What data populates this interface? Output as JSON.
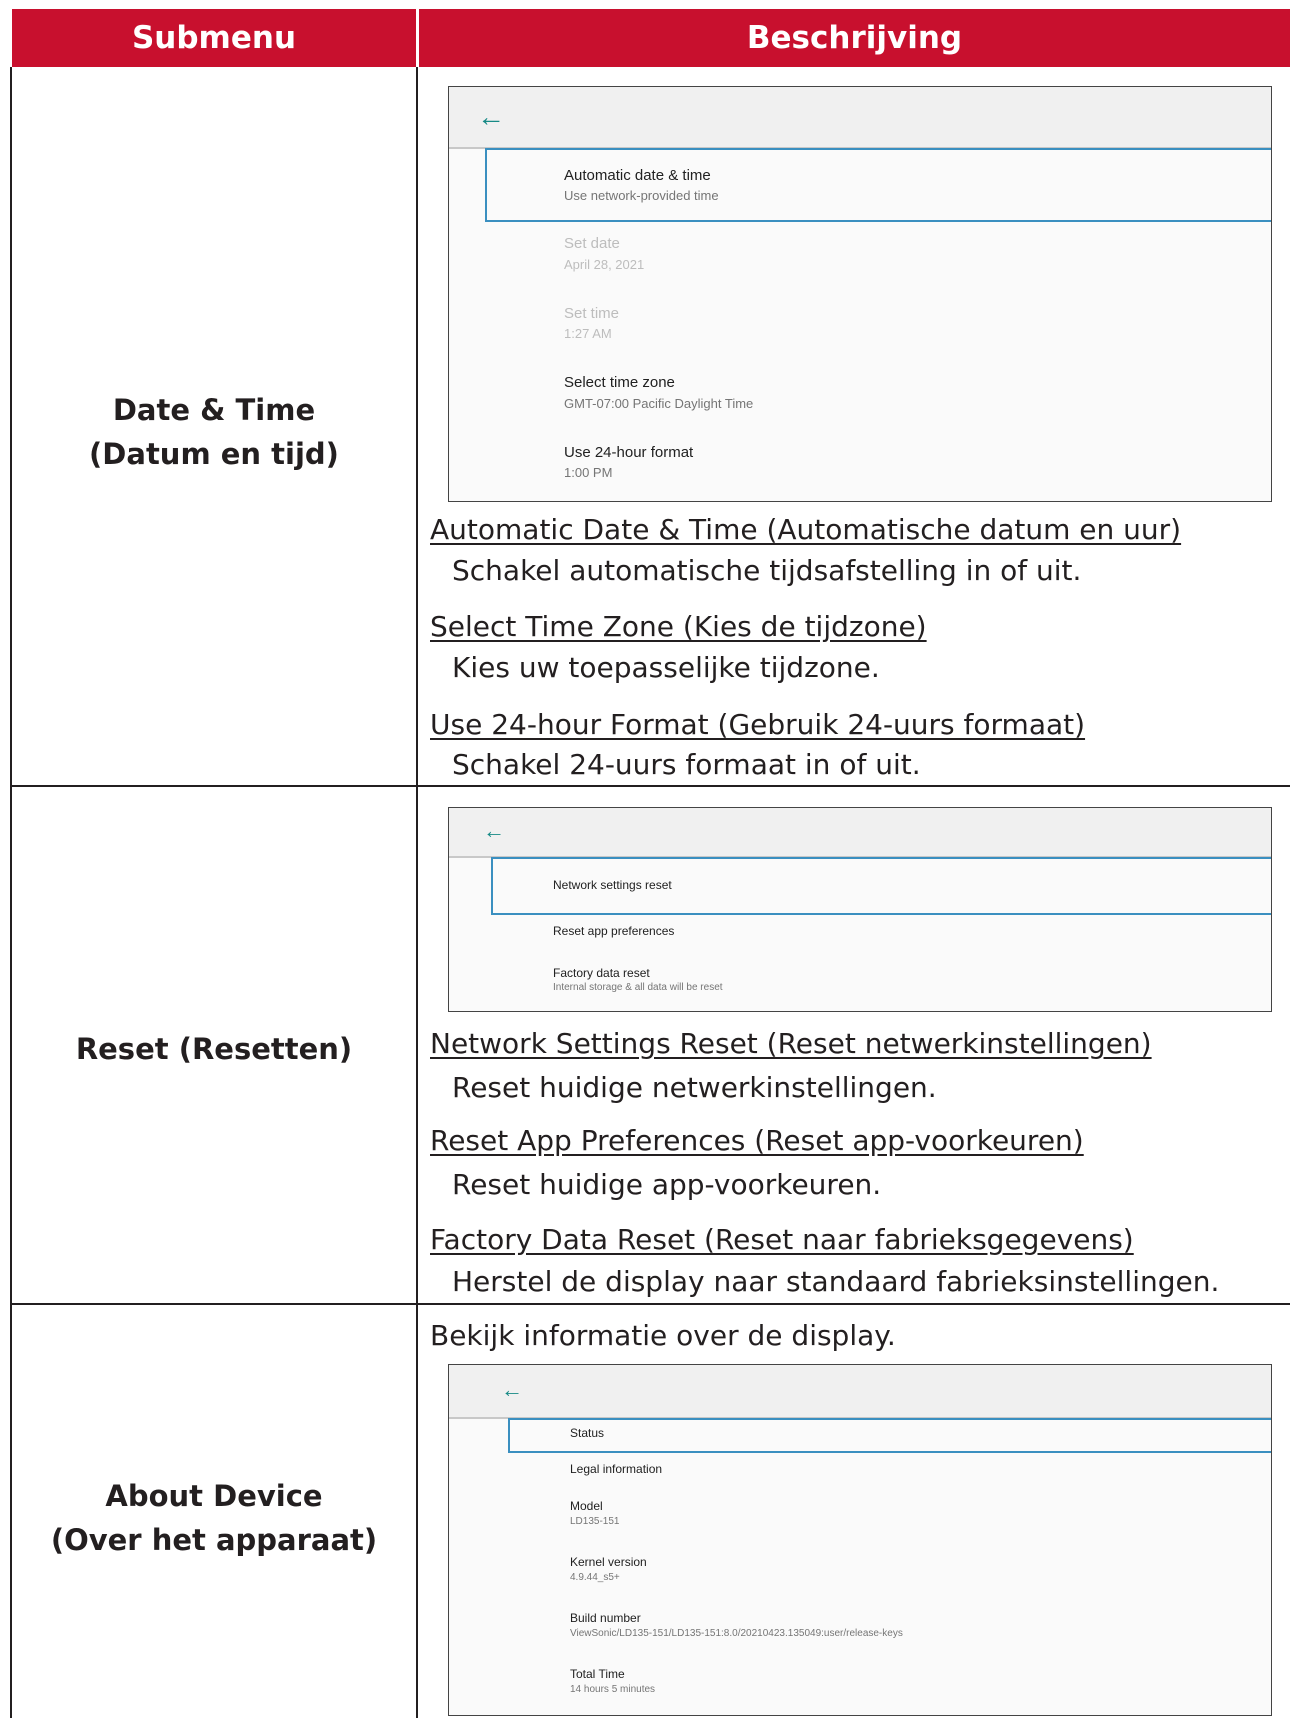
{
  "table": {
    "headers": {
      "submenu": "Submenu",
      "description": "Beschrijving"
    }
  },
  "rows": [
    {
      "label_line1": "Date & Time",
      "label_line2": "(Datum en tijd)",
      "screenshot": {
        "items": [
          {
            "title": "Automatic date & time",
            "subtitle": "Use network-provided time"
          },
          {
            "title": "Set date",
            "subtitle": "April 28, 2021"
          },
          {
            "title": "Set time",
            "subtitle": "1:27 AM"
          },
          {
            "title": "Select time zone",
            "subtitle": "GMT-07:00 Pacific Daylight Time"
          },
          {
            "title": "Use 24-hour format",
            "subtitle": "1:00 PM"
          }
        ]
      },
      "entries": [
        {
          "title": "Automatic Date & Time (Automatische datum en uur)",
          "desc": "Schakel automatische tijdsafstelling in of uit."
        },
        {
          "title": "Select Time Zone (Kies de tijdzone)",
          "desc": "Kies uw toepasselijke tijdzone."
        },
        {
          "title": "Use 24-hour Format (Gebruik 24-uurs formaat)",
          "desc": "Schakel 24-uurs formaat in of uit."
        }
      ]
    },
    {
      "label_line1": "Reset (Resetten)",
      "screenshot": {
        "items": [
          {
            "title": "Network settings reset"
          },
          {
            "title": "Reset app preferences"
          },
          {
            "title": "Factory data reset",
            "subtitle": "Internal storage & all data will be reset"
          }
        ]
      },
      "entries": [
        {
          "title": "Network Settings Reset (Reset netwerkinstellingen)",
          "desc": "Reset huidige netwerkinstellingen."
        },
        {
          "title": "Reset App Preferences (Reset app-voorkeuren)",
          "desc": "Reset huidige app-voorkeuren."
        },
        {
          "title": "Factory Data Reset (Reset naar fabrieksgegevens)",
          "desc": "Herstel de display naar standaard fabrieksinstellingen."
        }
      ]
    },
    {
      "label_line1": "About Device",
      "label_line2": "(Over het apparaat)",
      "intro": "Bekijk informatie over de display.",
      "screenshot": {
        "items": [
          {
            "title": "Status"
          },
          {
            "title": "Legal information"
          },
          {
            "title": "Model",
            "subtitle": "LD135-151"
          },
          {
            "title": "Kernel version",
            "subtitle": "4.9.44_s5+"
          },
          {
            "title": "Build number",
            "subtitle": "ViewSonic/LD135-151/LD135-151:8.0/20210423.135049:user/release-keys"
          },
          {
            "title": "Total Time",
            "subtitle": "14 hours 5 minutes"
          }
        ]
      }
    }
  ],
  "icons": {
    "back": "back-arrow-icon"
  },
  "colors": {
    "header_bg": "#c8102e",
    "accent_teal": "#178a86",
    "focus_blue": "#3a8fc0"
  }
}
